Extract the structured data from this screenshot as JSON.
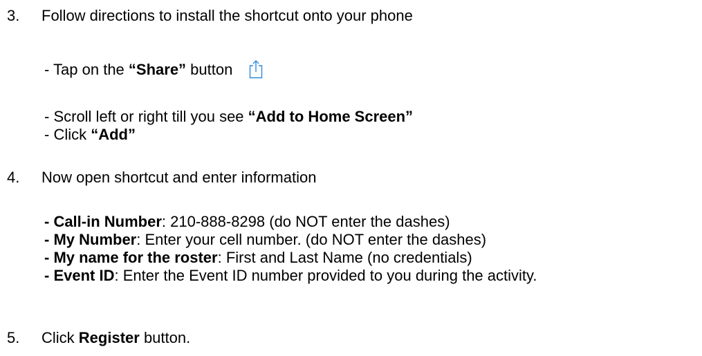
{
  "step3": {
    "number": "3.",
    "text": "Follow directions to install the shortcut onto your phone",
    "sub1_prefix": "- Tap on the ",
    "sub1_bold": "“Share”",
    "sub1_suffix": " button",
    "share_icon": "share-icon",
    "sub2_prefix": "- Scroll left or right till you see ",
    "sub2_bold": "“Add to Home Screen”",
    "sub3_prefix": "- Click ",
    "sub3_bold": "“Add”"
  },
  "step4": {
    "number": "4.",
    "text": "Now open shortcut and enter information",
    "fields": [
      {
        "label": "- Call-in Number",
        "value": ": 210-888-8298  (do NOT enter the dashes)"
      },
      {
        "label": "- My Number",
        "value": ": Enter your cell number.  (do NOT enter the dashes)"
      },
      {
        "label": "- My name for the roster",
        "value": ": First and Last Name (no credentials)"
      },
      {
        "label": "- Event ID",
        "value": ": Enter the Event ID number provided to you during the activity."
      }
    ]
  },
  "step5": {
    "number": "5.",
    "prefix": "Click ",
    "bold": "Register",
    "suffix": " button."
  },
  "colors": {
    "text": "#000000",
    "icon": "#2a8bdc"
  }
}
